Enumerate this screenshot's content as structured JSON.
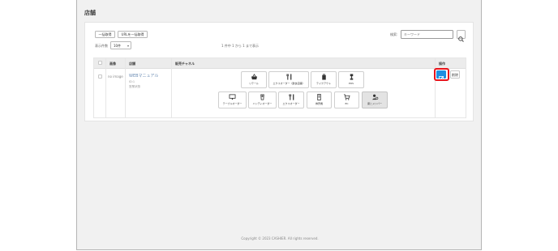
{
  "page": {
    "title": "店舗"
  },
  "toolbar": {
    "bulk_import_label": "一括取得",
    "url_bulk_label": "URLを一括取得",
    "display_count_label": "表示件数",
    "display_count_value": "10件",
    "count_summary": "1 件中 1 から 1 まで表示",
    "search_label": "検索:",
    "search_placeholder": "キーワード"
  },
  "table": {
    "headers": {
      "image": "画像",
      "store": "店舗",
      "channels": "販売チャネル",
      "actions": "操作"
    },
    "rows": [
      {
        "image": "no image",
        "store_name": "WEBマニュアル",
        "store_sub1": "ID:1",
        "store_sub2": "営業状態",
        "channels_row1": [
          {
            "label": "リテール",
            "icon": "basket-icon"
          },
          {
            "label": "エクスオーダー（飲食店舗）",
            "icon": "fork-knife-icon"
          },
          {
            "label": "テイクアウト",
            "icon": "takeout-bag-icon"
          },
          {
            "label": "POS",
            "icon": "pos-terminal-icon"
          }
        ],
        "channels_row2": [
          {
            "label": "テーブルオーダー",
            "icon": "table-order-icon"
          },
          {
            "label": "ハンディオーダー",
            "icon": "handy-device-icon"
          },
          {
            "label": "エクスオーダー",
            "icon": "fork-knife-icon"
          },
          {
            "label": "券売機",
            "icon": "ticket-machine-icon"
          },
          {
            "label": "EC",
            "icon": "cart-icon"
          },
          {
            "label": "席とメンバー",
            "icon": "member-seat-icon"
          }
        ],
        "edit_icon": "edit-icon",
        "delete_label": "削除"
      }
    ]
  },
  "footer": {
    "text": "Copyright © 2023 CASHIER. All rights reserved."
  },
  "colors": {
    "primary": "#1d8fe1",
    "highlight": "#e8141c"
  }
}
